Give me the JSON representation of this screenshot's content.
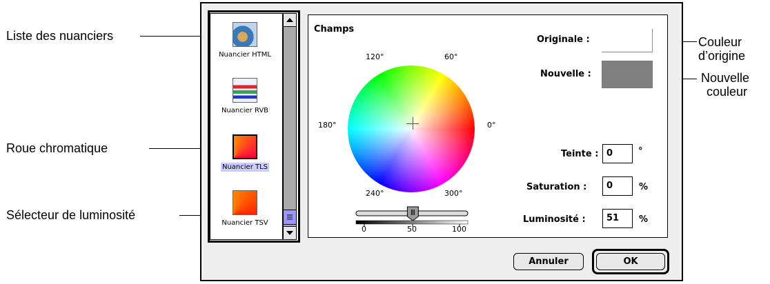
{
  "annotations": {
    "picker_list": "Liste des nuanciers",
    "original_color": [
      "Couleur",
      "d’origine"
    ],
    "new_color": [
      "Nouvelle",
      "couleur"
    ],
    "color_wheel": "Roue chromatique",
    "brightness_slider": "Sélecteur de luminosité"
  },
  "picker_list": {
    "items": [
      {
        "label": "Nuancier HTML",
        "icon": "html-picker-icon",
        "selected": false
      },
      {
        "label": "Nuancier RVB",
        "icon": "rgb-picker-icon",
        "selected": false
      },
      {
        "label": "Nuancier TLS",
        "icon": "hls-picker-icon",
        "selected": true
      },
      {
        "label": "Nuancier TSV",
        "icon": "hsv-picker-icon",
        "selected": false
      }
    ]
  },
  "panel": {
    "title": "Champs",
    "angles": {
      "a120": "120°",
      "a60": "60°",
      "a180": "180°",
      "a0": "0°",
      "a240": "240°",
      "a300": "300°"
    },
    "original_label": "Originale :",
    "new_label": "Nouvelle :",
    "original_color": "#ffffff",
    "new_color": "#808080",
    "hue": {
      "label": "Teinte :",
      "value": "0",
      "unit": "°"
    },
    "saturation": {
      "label": "Saturation :",
      "value": "0",
      "unit": "%"
    },
    "brightness": {
      "label": "Luminosité :",
      "value": "51",
      "unit": "%"
    },
    "slider": {
      "value_percent": 51,
      "ticks": [
        "0",
        "50",
        "100"
      ]
    }
  },
  "buttons": {
    "cancel": "Annuler",
    "ok": "OK"
  }
}
